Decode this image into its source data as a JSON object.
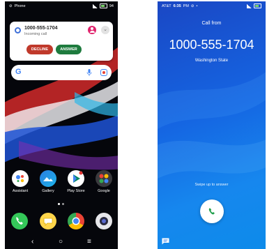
{
  "left": {
    "status": {
      "app": "Phone",
      "battery": "94"
    },
    "notification": {
      "number": "1000-555-1704",
      "subtitle": "Incoming call",
      "decline_label": "DECLINE",
      "answer_label": "ANSWER"
    },
    "apps": [
      {
        "label": "Assistant",
        "icon": "assistant-icon"
      },
      {
        "label": "Gallery",
        "icon": "gallery-icon"
      },
      {
        "label": "Play Store",
        "icon": "play-store-icon"
      },
      {
        "label": "Google",
        "icon": "google-folder-icon"
      }
    ],
    "dock": [
      "phone-icon",
      "messages-icon",
      "chrome-icon",
      "camera-icon"
    ],
    "nav": {
      "back": "‹",
      "home": "○",
      "recents": "≡"
    }
  },
  "right": {
    "status": {
      "carrier": "AT&T",
      "time": "6:35",
      "ampm": "PM"
    },
    "call_from": "Call from",
    "number": "1000-555-1704",
    "location": "Washington State",
    "swipe_hint": "Swipe up to answer"
  },
  "colors": {
    "decline": "#c0392b",
    "answer": "#1e7b3e",
    "incoming_bg": "#1565e2"
  }
}
